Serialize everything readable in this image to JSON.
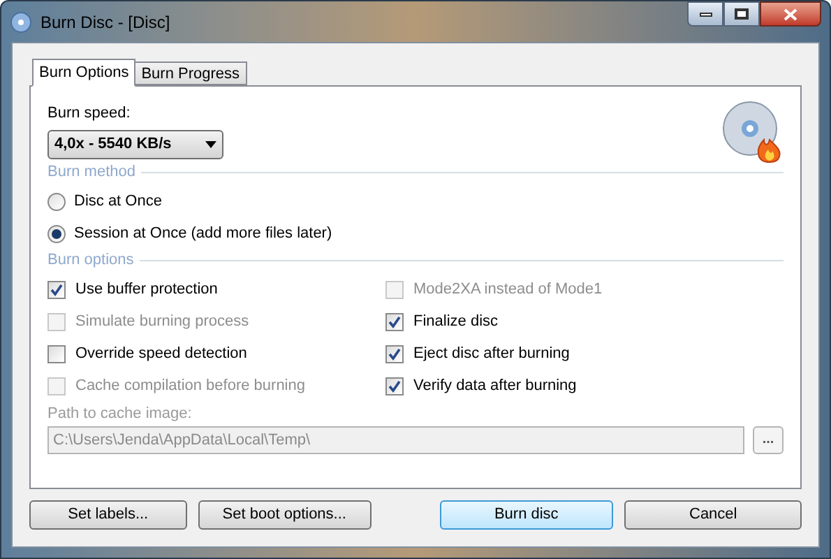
{
  "window": {
    "title": "Burn Disc - [Disc]"
  },
  "tabs": [
    {
      "label": "Burn Options",
      "selected": true
    },
    {
      "label": "Burn Progress",
      "selected": false
    }
  ],
  "burn_speed": {
    "label": "Burn speed:",
    "value": "4,0x - 5540 KB/s"
  },
  "burn_method": {
    "heading": "Burn method",
    "options": [
      {
        "label": "Disc at Once",
        "selected": false
      },
      {
        "label": "Session at Once (add more files later)",
        "selected": true
      }
    ]
  },
  "burn_options": {
    "heading": "Burn options",
    "items": [
      {
        "label": "Use buffer protection",
        "checked": true,
        "disabled": false
      },
      {
        "label": "Mode2XA instead of Mode1",
        "checked": false,
        "disabled": true
      },
      {
        "label": "Simulate burning process",
        "checked": false,
        "disabled": true
      },
      {
        "label": "Finalize disc",
        "checked": true,
        "disabled": false
      },
      {
        "label": "Override speed detection",
        "checked": false,
        "disabled": false
      },
      {
        "label": "Eject disc after burning",
        "checked": true,
        "disabled": false
      },
      {
        "label": "Cache compilation before burning",
        "checked": false,
        "disabled": true
      },
      {
        "label": "Verify data after burning",
        "checked": true,
        "disabled": false
      }
    ]
  },
  "cache_path": {
    "label": "Path to cache image:",
    "value": "C:\\Users\\Jenda\\AppData\\Local\\Temp\\",
    "browse": "..."
  },
  "buttons": [
    {
      "label": "Set labels...",
      "default": false
    },
    {
      "label": "Set boot options...",
      "default": false
    },
    {
      "label": "Burn disc",
      "default": true
    },
    {
      "label": "Cancel",
      "default": false
    }
  ]
}
